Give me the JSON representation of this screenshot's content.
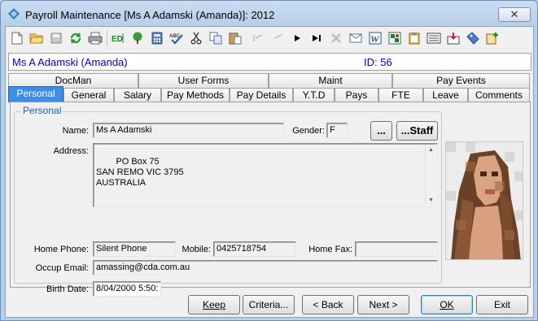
{
  "window": {
    "title": "Payroll Maintenance  [Ms A Adamski (Amanda)]:  2012",
    "close_glyph": "✕"
  },
  "toolbar": {
    "icons": [
      "new-icon",
      "open-icon",
      "save-icon",
      "refresh-icon",
      "print-icon",
      "edit-icon",
      "tree-icon",
      "calculator-icon",
      "spellcheck-icon",
      "cut-icon",
      "copy-icon",
      "paste-icon",
      "first-record-icon",
      "previous-record-icon",
      "next-record-icon",
      "last-record-icon",
      "delete-icon",
      "email-icon",
      "word-icon",
      "excel-icon",
      "clipboard-icon",
      "report-icon",
      "import-icon",
      "tag-icon",
      "add-document-icon"
    ]
  },
  "header": {
    "employee_name": "Ms A Adamski (Amanda)",
    "id_text": "ID: 56"
  },
  "tabs_top": [
    {
      "label": "DocMan"
    },
    {
      "label": "User Forms"
    },
    {
      "label": "Maint"
    },
    {
      "label": "Pay Events"
    }
  ],
  "tabs_bottom": [
    {
      "label": "Personal",
      "active": true
    },
    {
      "label": "General"
    },
    {
      "label": "Salary"
    },
    {
      "label": "Pay Methods"
    },
    {
      "label": "Pay Details"
    },
    {
      "label": "Y.T.D"
    },
    {
      "label": "Pays"
    },
    {
      "label": "FTE"
    },
    {
      "label": "Leave"
    },
    {
      "label": "Comments"
    }
  ],
  "personal": {
    "group_title": "Personal",
    "name_label": "Name:",
    "name_value": "Ms A Adamski",
    "gender_label": "Gender:",
    "gender_value": "F",
    "ellipsis_button": "...",
    "staff_button": "...Staff",
    "address_label": "Address:",
    "address_lines": "PO Box 75\nSAN REMO VIC 3795\nAUSTRALIA",
    "home_phone_label": "Home Phone:",
    "home_phone_value": "Silent Phone",
    "mobile_label": "Mobile:",
    "mobile_value": "0425718754",
    "home_fax_label": "Home Fax:",
    "home_fax_value": "",
    "occup_email_label": "Occup Email:",
    "occup_email_value": "amassing@cda.com.au",
    "birth_date_label": "Birth Date:",
    "birth_date_value": "8/04/2000 5:50:"
  },
  "buttons": {
    "keep": "Keep",
    "criteria": "Criteria...",
    "back": "< Back",
    "next": "Next >",
    "ok": "OK",
    "exit": "Exit"
  }
}
